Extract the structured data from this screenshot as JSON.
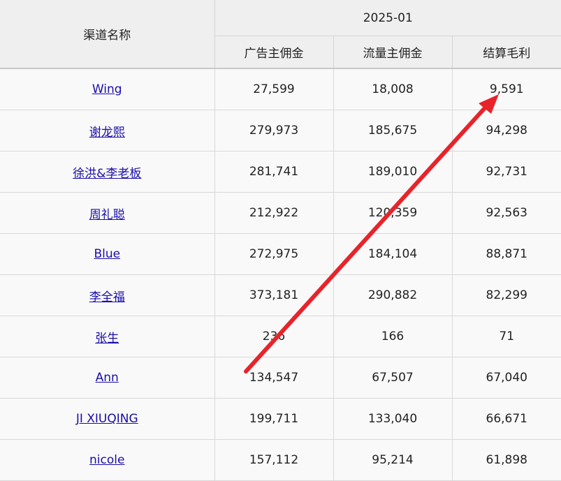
{
  "table": {
    "header": {
      "channel_col": "渠道名称",
      "period": "2025-01",
      "columns": [
        "广告主佣金",
        "流量主佣金",
        "结算毛利"
      ]
    },
    "rows": [
      {
        "name": "Wing",
        "advertiser": "27,599",
        "publisher": "18,008",
        "profit": "9,591"
      },
      {
        "name": "谢龙熙",
        "advertiser": "279,973",
        "publisher": "185,675",
        "profit": "94,298"
      },
      {
        "name": "徐洪&李老板",
        "advertiser": "281,741",
        "publisher": "189,010",
        "profit": "92,731"
      },
      {
        "name": "周礼聪",
        "advertiser": "212,922",
        "publisher": "120,359",
        "profit": "92,563"
      },
      {
        "name": "Blue",
        "advertiser": "272,975",
        "publisher": "184,104",
        "profit": "88,871"
      },
      {
        "name": "李全福",
        "advertiser": "373,181",
        "publisher": "290,882",
        "profit": "82,299"
      },
      {
        "name": "张生",
        "advertiser": "236",
        "publisher": "166",
        "profit": "71"
      },
      {
        "name": "Ann",
        "advertiser": "134,547",
        "publisher": "67,507",
        "profit": "67,040"
      },
      {
        "name": "JI XIUQING",
        "advertiser": "199,711",
        "publisher": "133,040",
        "profit": "66,671"
      },
      {
        "name": "nicole",
        "advertiser": "157,112",
        "publisher": "95,214",
        "profit": "61,898"
      }
    ]
  },
  "annotation": {
    "icon": "red-arrow",
    "color": "#e8232a"
  }
}
